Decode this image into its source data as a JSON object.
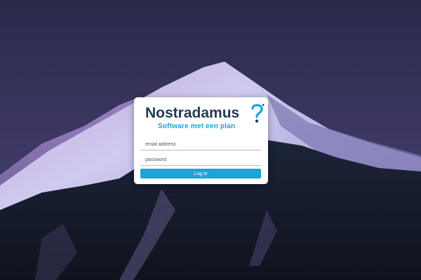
{
  "background": {
    "sky_top": "#2b2a4a",
    "sky_glow": "#6a4f86",
    "snow": "#c9c6ea",
    "forest": "#141b2c"
  },
  "login": {
    "logo": {
      "wordmark": "Nostradamus",
      "tagline": "Software met een plan",
      "wordmark_color": "#243b55",
      "tagline_color": "#19a4d8",
      "mark_icon": "swirl-question-mark-icon"
    },
    "email_placeholder": "email address",
    "password_placeholder": "password",
    "submit_label": "Log in",
    "accent": "#1fa3d6"
  }
}
